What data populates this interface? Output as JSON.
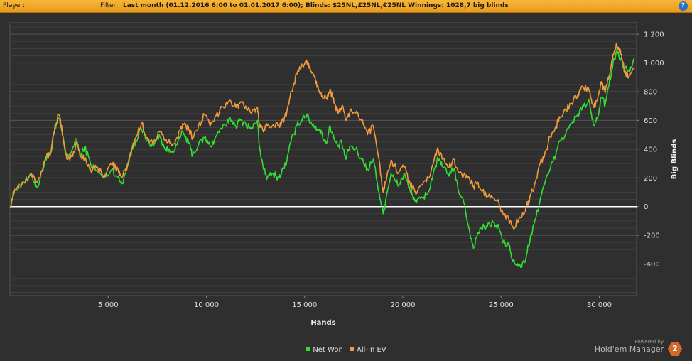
{
  "header": {
    "player_label": "Player:",
    "player_value": "",
    "filter_label": "Filter:",
    "filter_text": "Last month (01.12.2016 6:00 to 01.01.2017 6:00); Blinds: $25NL,£25NL,€25NL  Winnings:  1028,7 big blinds",
    "help_icon": "help-icon"
  },
  "branding": {
    "powered_by": "Powered by",
    "name": "Hold'em Manager",
    "logo_text": "2"
  },
  "chart_data": {
    "type": "line",
    "xlabel": "Hands",
    "ylabel": "Big Blinds",
    "xlim": [
      0,
      31900
    ],
    "ylim": [
      -620,
      1280
    ],
    "x_ticks": [
      5000,
      10000,
      15000,
      20000,
      25000,
      30000
    ],
    "x_tick_labels": [
      "5 000",
      "10 000",
      "15 000",
      "20 000",
      "25 000",
      "30 000"
    ],
    "y_ticks": [
      1200,
      1000,
      800,
      600,
      400,
      200,
      0,
      -200,
      -400
    ],
    "y_tick_labels": [
      "1 200",
      "1 000",
      "800",
      "600",
      "400",
      "200",
      "0",
      "-200",
      "-400"
    ],
    "grid": true,
    "legend_position": "bottom",
    "colors": {
      "background": "#2f2f2f",
      "grid": "#4a4a4a",
      "zero_line": "#ffffff",
      "text": "#e0e0e0"
    },
    "series": [
      {
        "name": "Net Won",
        "color": "#33dd33",
        "points": [
          [
            0,
            0
          ],
          [
            250,
            120
          ],
          [
            700,
            170
          ],
          [
            1100,
            210
          ],
          [
            1400,
            130
          ],
          [
            1800,
            330
          ],
          [
            2100,
            380
          ],
          [
            2300,
            560
          ],
          [
            2500,
            610
          ],
          [
            2700,
            480
          ],
          [
            2900,
            330
          ],
          [
            3200,
            410
          ],
          [
            3400,
            470
          ],
          [
            3600,
            350
          ],
          [
            3800,
            420
          ],
          [
            4100,
            300
          ],
          [
            4400,
            250
          ],
          [
            4800,
            200
          ],
          [
            5200,
            260
          ],
          [
            5500,
            200
          ],
          [
            5700,
            160
          ],
          [
            6000,
            300
          ],
          [
            6200,
            390
          ],
          [
            6400,
            460
          ],
          [
            6700,
            540
          ],
          [
            7000,
            460
          ],
          [
            7300,
            420
          ],
          [
            7600,
            500
          ],
          [
            7900,
            400
          ],
          [
            8200,
            380
          ],
          [
            8500,
            430
          ],
          [
            8800,
            520
          ],
          [
            9100,
            440
          ],
          [
            9300,
            360
          ],
          [
            9600,
            430
          ],
          [
            9900,
            480
          ],
          [
            10200,
            420
          ],
          [
            10400,
            460
          ],
          [
            10700,
            540
          ],
          [
            11000,
            560
          ],
          [
            11200,
            620
          ],
          [
            11500,
            560
          ],
          [
            11700,
            600
          ],
          [
            12000,
            580
          ],
          [
            12300,
            540
          ],
          [
            12600,
            600
          ],
          [
            12700,
            420
          ],
          [
            12900,
            260
          ],
          [
            13100,
            200
          ],
          [
            13400,
            230
          ],
          [
            13700,
            200
          ],
          [
            13900,
            260
          ],
          [
            14100,
            320
          ],
          [
            14300,
            450
          ],
          [
            14600,
            560
          ],
          [
            14900,
            620
          ],
          [
            15100,
            640
          ],
          [
            15300,
            590
          ],
          [
            15500,
            560
          ],
          [
            15700,
            540
          ],
          [
            15900,
            500
          ],
          [
            16100,
            440
          ],
          [
            16300,
            560
          ],
          [
            16500,
            470
          ],
          [
            16700,
            420
          ],
          [
            16900,
            440
          ],
          [
            17100,
            330
          ],
          [
            17300,
            420
          ],
          [
            17600,
            400
          ],
          [
            17900,
            330
          ],
          [
            18200,
            260
          ],
          [
            18500,
            330
          ],
          [
            18800,
            90
          ],
          [
            19000,
            -50
          ],
          [
            19200,
            100
          ],
          [
            19400,
            230
          ],
          [
            19600,
            180
          ],
          [
            19800,
            150
          ],
          [
            20100,
            230
          ],
          [
            20300,
            130
          ],
          [
            20500,
            80
          ],
          [
            20700,
            30
          ],
          [
            21000,
            60
          ],
          [
            21300,
            100
          ],
          [
            21600,
            260
          ],
          [
            21800,
            330
          ],
          [
            22000,
            280
          ],
          [
            22300,
            230
          ],
          [
            22600,
            260
          ],
          [
            22800,
            130
          ],
          [
            23100,
            30
          ],
          [
            23400,
            -170
          ],
          [
            23600,
            -290
          ],
          [
            23800,
            -190
          ],
          [
            24000,
            -150
          ],
          [
            24300,
            -140
          ],
          [
            24600,
            -110
          ],
          [
            24900,
            -150
          ],
          [
            25100,
            -250
          ],
          [
            25400,
            -270
          ],
          [
            25600,
            -380
          ],
          [
            25900,
            -420
          ],
          [
            26200,
            -390
          ],
          [
            26400,
            -270
          ],
          [
            26600,
            -170
          ],
          [
            26800,
            -60
          ],
          [
            27000,
            60
          ],
          [
            27200,
            150
          ],
          [
            27500,
            260
          ],
          [
            27800,
            370
          ],
          [
            28000,
            460
          ],
          [
            28300,
            510
          ],
          [
            28600,
            580
          ],
          [
            28900,
            640
          ],
          [
            29200,
            700
          ],
          [
            29500,
            730
          ],
          [
            29700,
            560
          ],
          [
            29900,
            610
          ],
          [
            30100,
            760
          ],
          [
            30300,
            710
          ],
          [
            30500,
            850
          ],
          [
            30700,
            1000
          ],
          [
            30900,
            1080
          ],
          [
            31100,
            1030
          ],
          [
            31300,
            960
          ],
          [
            31500,
            950
          ],
          [
            31800,
            1030
          ]
        ]
      },
      {
        "name": "All-In EV",
        "color": "#f39a3c",
        "points": [
          [
            0,
            0
          ],
          [
            250,
            120
          ],
          [
            700,
            170
          ],
          [
            1100,
            230
          ],
          [
            1400,
            170
          ],
          [
            1800,
            330
          ],
          [
            2100,
            390
          ],
          [
            2300,
            570
          ],
          [
            2500,
            640
          ],
          [
            2700,
            490
          ],
          [
            2900,
            330
          ],
          [
            3200,
            350
          ],
          [
            3400,
            450
          ],
          [
            3600,
            350
          ],
          [
            3800,
            330
          ],
          [
            4100,
            260
          ],
          [
            4400,
            270
          ],
          [
            4800,
            220
          ],
          [
            5200,
            290
          ],
          [
            5500,
            260
          ],
          [
            5700,
            200
          ],
          [
            6000,
            290
          ],
          [
            6200,
            400
          ],
          [
            6400,
            480
          ],
          [
            6700,
            580
          ],
          [
            7000,
            480
          ],
          [
            7300,
            440
          ],
          [
            7600,
            520
          ],
          [
            7900,
            460
          ],
          [
            8200,
            440
          ],
          [
            8500,
            480
          ],
          [
            8800,
            580
          ],
          [
            9100,
            540
          ],
          [
            9300,
            480
          ],
          [
            9600,
            560
          ],
          [
            9900,
            640
          ],
          [
            10200,
            560
          ],
          [
            10400,
            600
          ],
          [
            10700,
            680
          ],
          [
            11000,
            720
          ],
          [
            11200,
            740
          ],
          [
            11500,
            690
          ],
          [
            11700,
            720
          ],
          [
            12000,
            700
          ],
          [
            12300,
            650
          ],
          [
            12600,
            690
          ],
          [
            12700,
            570
          ],
          [
            12900,
            520
          ],
          [
            13100,
            560
          ],
          [
            13400,
            570
          ],
          [
            13700,
            560
          ],
          [
            13900,
            600
          ],
          [
            14100,
            660
          ],
          [
            14300,
            800
          ],
          [
            14600,
            920
          ],
          [
            14900,
            980
          ],
          [
            15100,
            1020
          ],
          [
            15300,
            950
          ],
          [
            15500,
            900
          ],
          [
            15700,
            820
          ],
          [
            15900,
            770
          ],
          [
            16100,
            760
          ],
          [
            16300,
            820
          ],
          [
            16500,
            720
          ],
          [
            16700,
            650
          ],
          [
            16900,
            700
          ],
          [
            17100,
            600
          ],
          [
            17300,
            660
          ],
          [
            17600,
            650
          ],
          [
            17900,
            600
          ],
          [
            18200,
            500
          ],
          [
            18500,
            560
          ],
          [
            18800,
            320
          ],
          [
            19000,
            100
          ],
          [
            19200,
            220
          ],
          [
            19400,
            320
          ],
          [
            19600,
            280
          ],
          [
            19800,
            240
          ],
          [
            20100,
            280
          ],
          [
            20300,
            180
          ],
          [
            20500,
            140
          ],
          [
            20700,
            90
          ],
          [
            21000,
            150
          ],
          [
            21300,
            200
          ],
          [
            21600,
            330
          ],
          [
            21800,
            400
          ],
          [
            22000,
            330
          ],
          [
            22300,
            270
          ],
          [
            22600,
            330
          ],
          [
            22800,
            250
          ],
          [
            23100,
            220
          ],
          [
            23400,
            190
          ],
          [
            23600,
            140
          ],
          [
            23800,
            170
          ],
          [
            24000,
            110
          ],
          [
            24300,
            70
          ],
          [
            24600,
            60
          ],
          [
            24900,
            20
          ],
          [
            25100,
            -50
          ],
          [
            25400,
            -90
          ],
          [
            25600,
            -140
          ],
          [
            25900,
            -90
          ],
          [
            26200,
            -40
          ],
          [
            26400,
            40
          ],
          [
            26600,
            110
          ],
          [
            26800,
            200
          ],
          [
            27000,
            300
          ],
          [
            27200,
            350
          ],
          [
            27500,
            490
          ],
          [
            27800,
            560
          ],
          [
            28000,
            620
          ],
          [
            28300,
            670
          ],
          [
            28600,
            720
          ],
          [
            28900,
            780
          ],
          [
            29200,
            830
          ],
          [
            29500,
            800
          ],
          [
            29700,
            700
          ],
          [
            29900,
            740
          ],
          [
            30100,
            870
          ],
          [
            30300,
            790
          ],
          [
            30500,
            910
          ],
          [
            30700,
            1060
          ],
          [
            30900,
            1120
          ],
          [
            31100,
            1060
          ],
          [
            31300,
            930
          ],
          [
            31500,
            900
          ],
          [
            31800,
            960
          ]
        ]
      }
    ]
  }
}
